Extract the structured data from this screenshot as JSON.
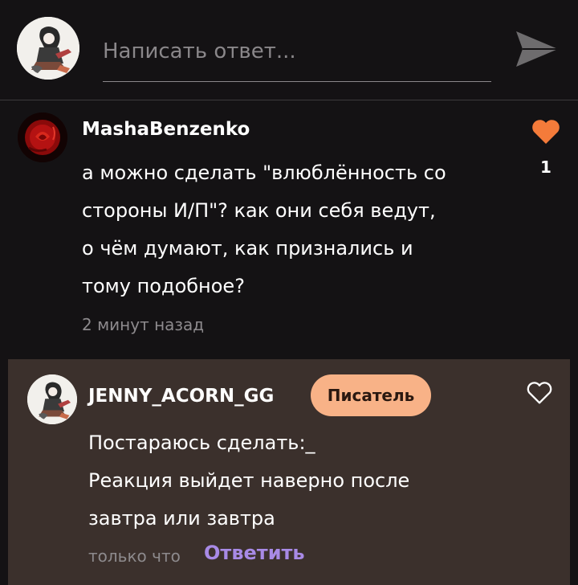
{
  "reply_bar": {
    "placeholder": "Написать ответ...",
    "avatar_icon": "anime-character-avatar",
    "send_icon": "send-arrow-icon"
  },
  "comment": {
    "username": "MashaBenzenko",
    "text": "а можно сделать \"влюблённость со\nстороны И/П\"? как они себя ведут,\nо чём думают, как признались и\nтому подобное?",
    "timestamp": "2 минут назад",
    "like_count": "1",
    "liked": true,
    "avatar_icon": "red-rose-avatar",
    "like_color": "#f47b3a"
  },
  "reply": {
    "username": "JENNY_ACORN_GG",
    "badge": "Писатель",
    "text": "Постараюсь сделать:_\nРеакция выйдет наверно после\nзавтра или завтра",
    "timestamp": "только что",
    "answer_label": "Ответить",
    "liked": false,
    "avatar_icon": "anime-character-avatar",
    "card_color": "#3b302c",
    "badge_color": "#f8b287",
    "link_color": "#a88ae6"
  }
}
